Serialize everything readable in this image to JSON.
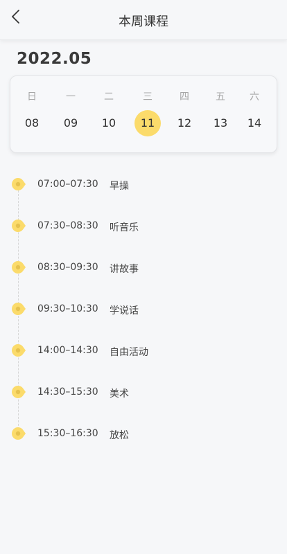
{
  "header": {
    "title": "本周课程"
  },
  "month": "2022.05",
  "accent_color": "#fbdb6b",
  "calendar": {
    "days": [
      {
        "weekday": "日",
        "date": "08",
        "selected": false
      },
      {
        "weekday": "一",
        "date": "09",
        "selected": false
      },
      {
        "weekday": "二",
        "date": "10",
        "selected": false
      },
      {
        "weekday": "三",
        "date": "11",
        "selected": true
      },
      {
        "weekday": "四",
        "date": "12",
        "selected": false
      },
      {
        "weekday": "五",
        "date": "13",
        "selected": false
      },
      {
        "weekday": "六",
        "date": "14",
        "selected": false
      }
    ]
  },
  "schedule": [
    {
      "time": "07:00–07:30",
      "name": "早操"
    },
    {
      "time": "07:30–08:30",
      "name": "听音乐"
    },
    {
      "time": "08:30–09:30",
      "name": "讲故事"
    },
    {
      "time": "09:30–10:30",
      "name": "学说话"
    },
    {
      "time": "14:00–14:30",
      "name": "自由活动"
    },
    {
      "time": "14:30–15:30",
      "name": "美术"
    },
    {
      "time": "15:30–16:30",
      "name": "放松"
    }
  ],
  "icons": {
    "back": "chevron-left-icon",
    "timeline_marker": "location-pin-icon"
  }
}
